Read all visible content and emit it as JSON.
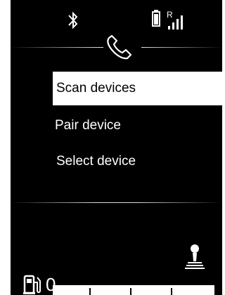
{
  "status_bar": {
    "bluetooth_icon": "bluetooth-icon",
    "battery_icon": "phone-battery-icon",
    "signal_icon": "signal-roaming-icon",
    "roaming_mark": "R"
  },
  "header": {
    "icon": "phone-handset-icon"
  },
  "menu": {
    "items": [
      {
        "label": "Scan devices",
        "selected": true
      },
      {
        "label": "Pair device",
        "selected": false
      },
      {
        "label": "Select device",
        "selected": false
      }
    ]
  },
  "footer": {
    "gear_icon": "gear-shift-icon",
    "fuel_icon": "fuel-pump-icon",
    "fuel_level": "0"
  },
  "colors": {
    "background": "#000000",
    "foreground": "#ffffff",
    "selected_bg": "#ffffff",
    "selected_fg": "#000000"
  }
}
